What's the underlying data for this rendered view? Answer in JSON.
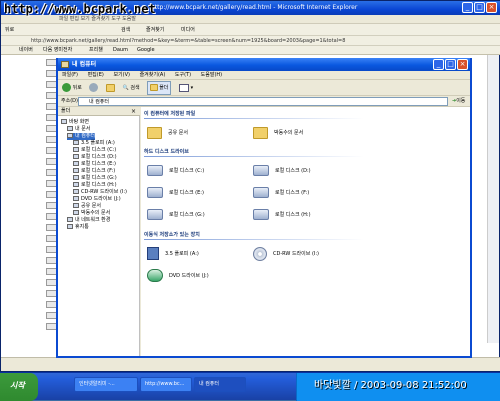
{
  "watermark": "http://www.bcpark.net",
  "ie": {
    "title": "http://www.bcpark.net/gallery/read.html - Microsoft Internet Explorer",
    "menu": "파일  편집  보기  즐겨찾기  도구  도움말",
    "toolbar": [
      "뒤로",
      "검색",
      "즐겨찾기",
      "미디어"
    ],
    "address": "http://www.bcpark.net/gallery/read.html?method=&key=&term=&table=screen&num=1925&board=2003&page=1&total=8",
    "links": [
      "네이버",
      "다음 영미전자",
      "프리챌",
      "Daum",
      "Google"
    ]
  },
  "explorer": {
    "title": "내 컴퓨터",
    "menu": [
      "파일(F)",
      "편집(E)",
      "보기(V)",
      "즐겨찾기(A)",
      "도구(T)",
      "도움말(H)"
    ],
    "toolbar": {
      "back": "뒤로",
      "search": "검색",
      "folders": "폴더"
    },
    "address_label": "주소(D)",
    "address": "내 컴퓨터",
    "go": "이동",
    "tree": {
      "header": "폴더",
      "nodes": [
        {
          "label": "바탕 화면",
          "indent": 0
        },
        {
          "label": "내 문서",
          "indent": 1
        },
        {
          "label": "내 컴퓨터",
          "indent": 1,
          "selected": true
        },
        {
          "label": "3.5 플로피 (A:)",
          "indent": 2
        },
        {
          "label": "로컬 디스크 (C:)",
          "indent": 2
        },
        {
          "label": "로컬 디스크 (D:)",
          "indent": 2
        },
        {
          "label": "로컬 디스크 (E:)",
          "indent": 2
        },
        {
          "label": "로컬 디스크 (F:)",
          "indent": 2
        },
        {
          "label": "로컬 디스크 (G:)",
          "indent": 2
        },
        {
          "label": "로컬 디스크 (H:)",
          "indent": 2
        },
        {
          "label": "CD-RW 드라이브 (I:)",
          "indent": 2
        },
        {
          "label": "DVD 드라이브 (J:)",
          "indent": 2
        },
        {
          "label": "공유 문서",
          "indent": 2
        },
        {
          "label": "박동수의 문서",
          "indent": 2
        },
        {
          "label": "내 네트워크 환경",
          "indent": 1
        },
        {
          "label": "휴지통",
          "indent": 1
        }
      ]
    },
    "groups": {
      "files": "이 컴퓨터에 저장된 파일",
      "drives": "하드 디스크 드라이브",
      "removable": "이동식 저장소가 있는 장치"
    },
    "files": [
      "공유 문서",
      "박동수의 문서"
    ],
    "drives": [
      "로컬 디스크 (C:)",
      "로컬 디스크 (D:)",
      "로컬 디스크 (E:)",
      "로컬 디스크 (F:)",
      "로컬 디스크 (G:)",
      "로컬 디스크 (H:)"
    ],
    "removable": [
      "3.5 플로피 (A:)",
      "CD-RW 드라이브 (I:)",
      "DVD 드라이브 (J:)"
    ]
  },
  "taskbar": {
    "start": "시작",
    "tasks": [
      "인터넷알리미 -...",
      "http://www.bc...",
      "내 컴퓨터"
    ],
    "stamp": "바닷빛깔 / 2003-09-08 21:52:00"
  }
}
